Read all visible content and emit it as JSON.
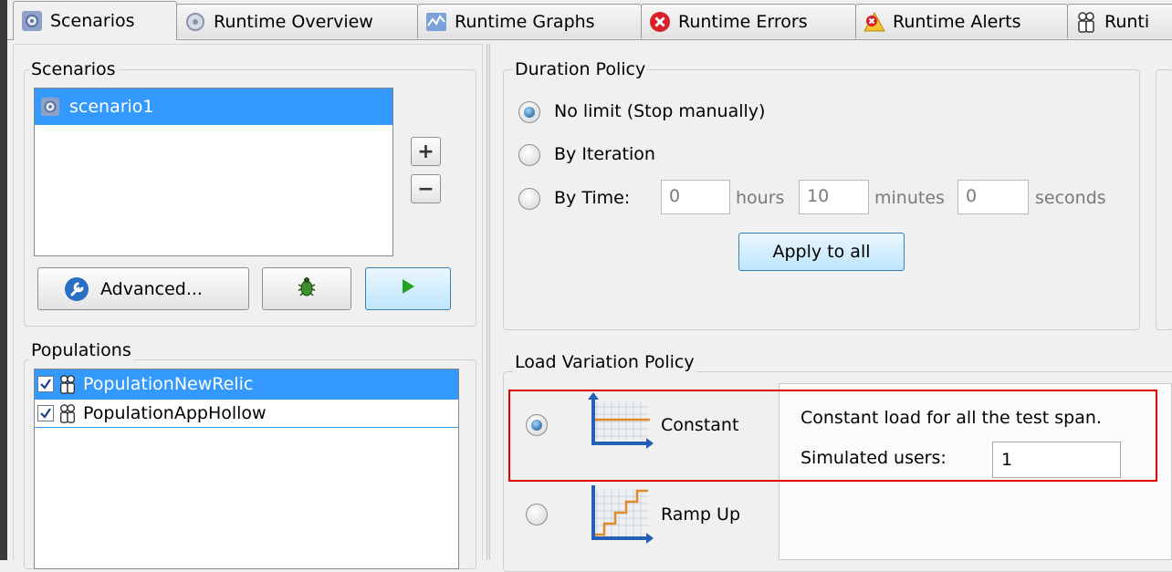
{
  "tabs": [
    {
      "label": "Scenarios",
      "icon": "gear-icon"
    },
    {
      "label": "Runtime Overview",
      "icon": "gear-icon"
    },
    {
      "label": "Runtime Graphs",
      "icon": "graph-icon"
    },
    {
      "label": "Runtime Errors",
      "icon": "error-icon"
    },
    {
      "label": "Runtime Alerts",
      "icon": "alert-icon"
    },
    {
      "label": "Runti",
      "icon": "users-icon"
    }
  ],
  "scenarios": {
    "title": "Scenarios",
    "items": [
      "scenario1"
    ],
    "add_label": "+",
    "remove_label": "−",
    "advanced_label": "Advanced..."
  },
  "populations": {
    "title": "Populations",
    "items": [
      {
        "label": "PopulationNewRelic",
        "checked": true,
        "selected": true
      },
      {
        "label": "PopulationAppHollow",
        "checked": true,
        "selected": false
      }
    ]
  },
  "duration": {
    "title": "Duration Policy",
    "options": [
      "No limit (Stop manually)",
      "By Iteration",
      "By Time:"
    ],
    "selected": "No limit (Stop manually)",
    "hours_value": "0",
    "hours_label": "hours",
    "minutes_value": "10",
    "minutes_label": "minutes",
    "seconds_value": "0",
    "seconds_label": "seconds",
    "apply_label": "Apply to all"
  },
  "load": {
    "title": "Load Variation Policy",
    "constant_label": "Constant",
    "rampup_label": "Ramp Up",
    "selected": "Constant",
    "description": "Constant load for all the test span.",
    "users_label": "Simulated users:",
    "users_value": "1"
  },
  "colors": {
    "selection": "#3399ff",
    "highlight_border": "#e00000",
    "play": "#1fa51f"
  }
}
